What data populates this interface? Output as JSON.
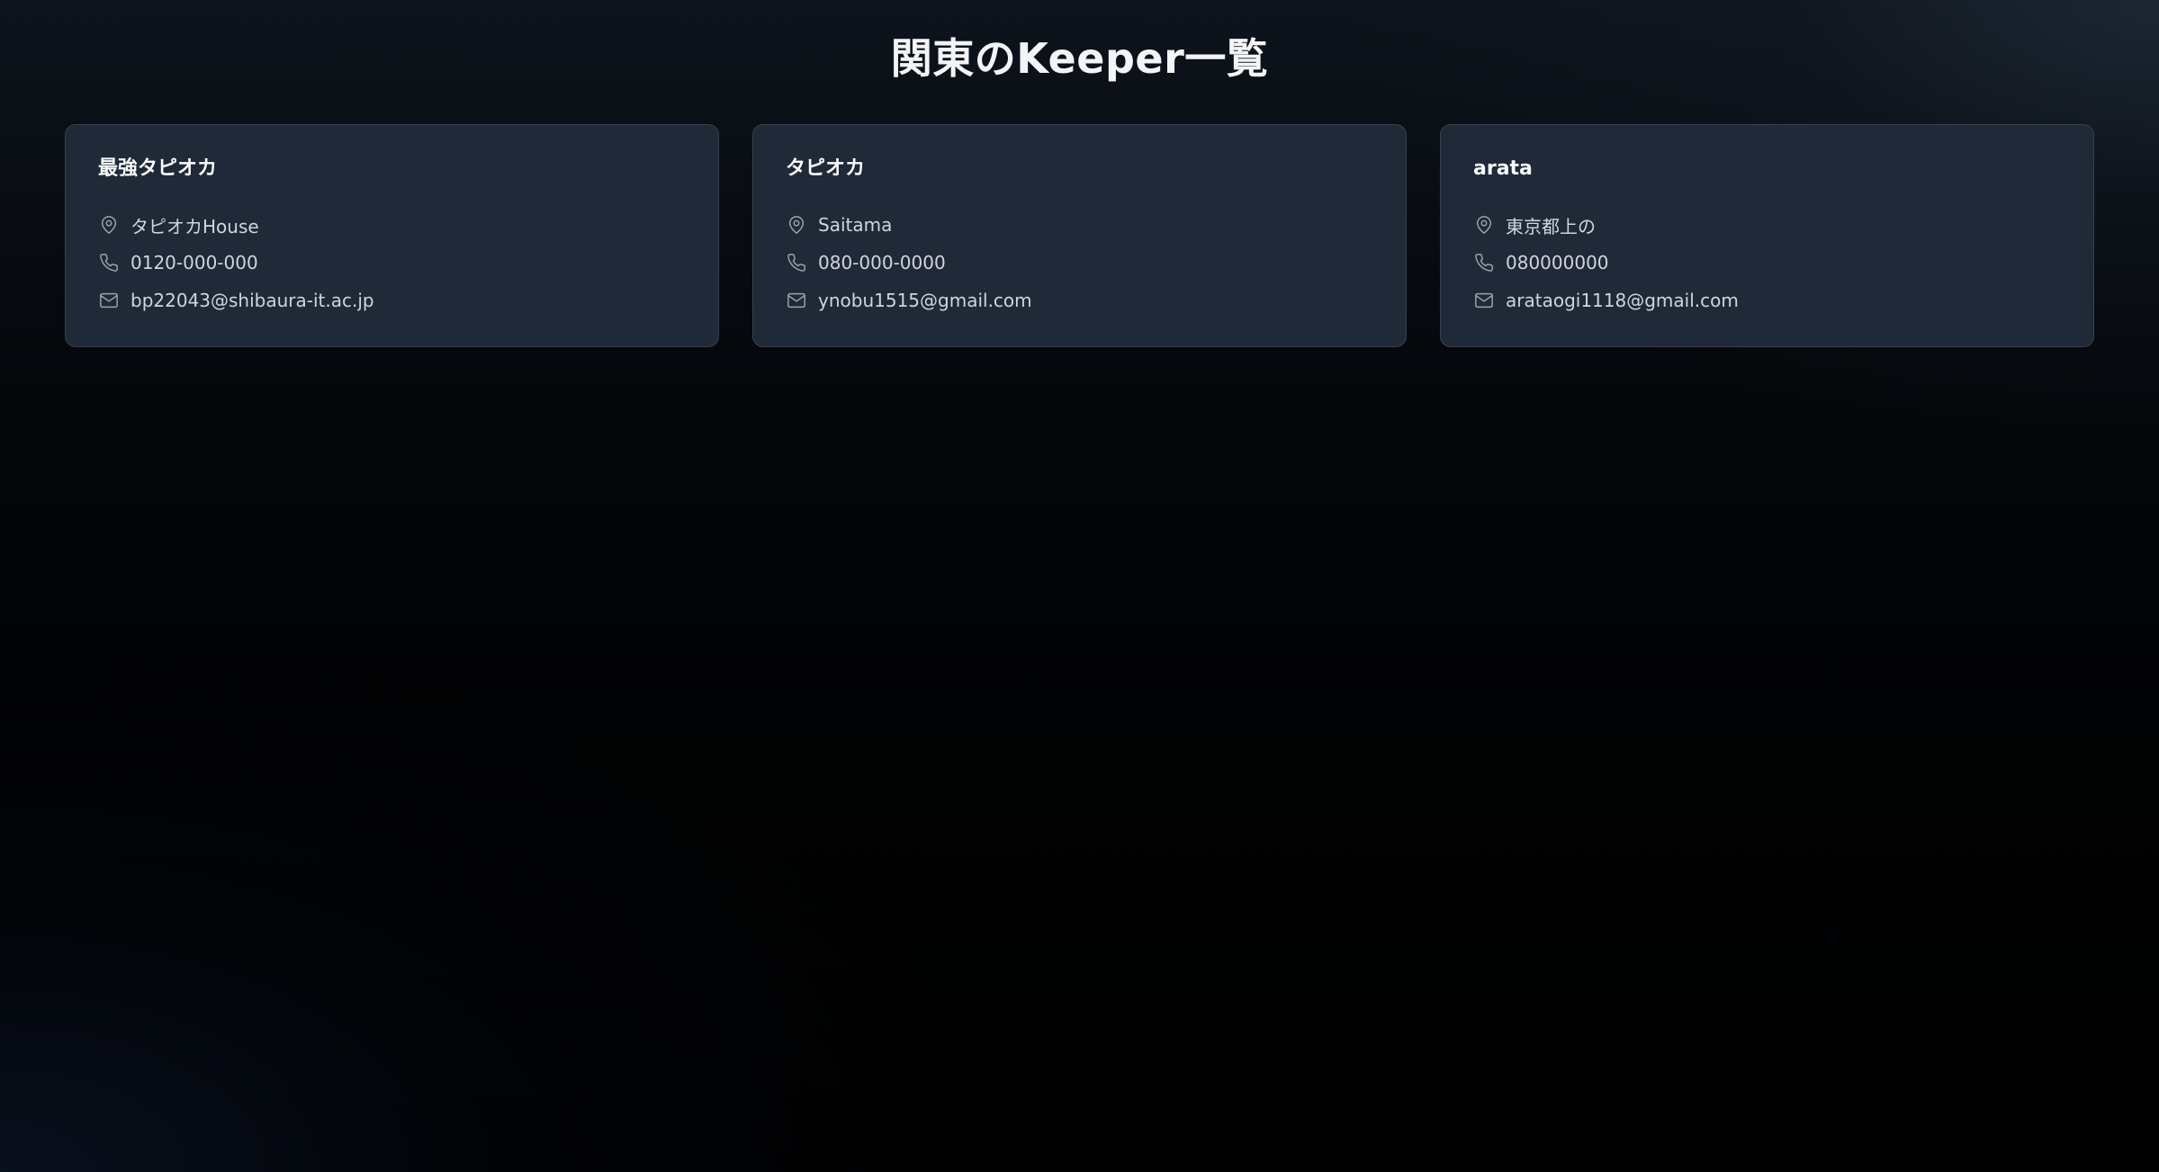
{
  "page": {
    "title": "関東のKeeper一覧"
  },
  "keepers": [
    {
      "name": "最強タピオカ",
      "address": "タピオカHouse",
      "phone": "0120-000-000",
      "email": "bp22043@shibaura-it.ac.jp"
    },
    {
      "name": "タピオカ",
      "address": "Saitama",
      "phone": "080-000-0000",
      "email": "ynobu1515@gmail.com"
    },
    {
      "name": "arata",
      "address": "東京都上の",
      "phone": "080000000",
      "email": "arataogi1118@gmail.com"
    }
  ],
  "icons": {
    "address": "map-pin-icon",
    "phone": "phone-icon",
    "email": "mail-icon"
  },
  "colors": {
    "card_background": "#1f2937",
    "card_border": "#374151",
    "title_text": "#f3f4f6",
    "body_text": "#d1d5db",
    "icon_stroke": "#9ca3af"
  }
}
